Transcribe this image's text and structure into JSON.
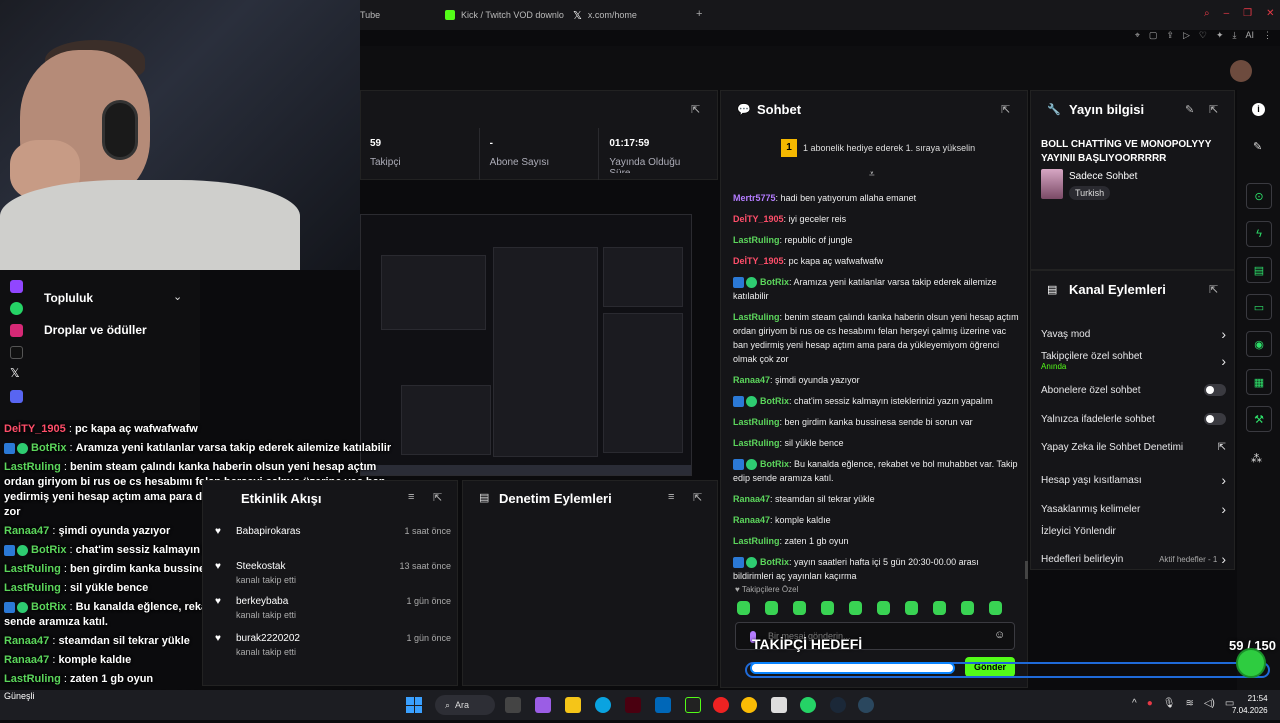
{
  "browser": {
    "tabs": [
      {
        "label": "Tube",
        "color": "#e62117"
      },
      {
        "label": "Kick / Twitch VOD downlo",
        "color": "#53fc18"
      },
      {
        "label": "x.com/home",
        "color": "#ffffff"
      }
    ],
    "new_tab": "+",
    "ai_label": "AI"
  },
  "stats": {
    "followers_value": "59",
    "followers_label": "Takipçi",
    "subs_value": "-",
    "subs_label": "Abone Sayısı",
    "uptime_value": "01:17:59",
    "uptime_label": "Yayında Olduğu Süre"
  },
  "chat": {
    "title": "Sohbet",
    "gift_banner": "1 abonelik hediye ederek 1. sıraya yükselin",
    "gift_rank": "1",
    "messages": [
      {
        "user": "Mertr5775",
        "color": "purple",
        "text": "hadi ben yatıyorum allaha emanet",
        "bot": false
      },
      {
        "user": "DeİTY_1905",
        "color": "red",
        "text": "iyi geceler reis",
        "bot": false
      },
      {
        "user": "LastRuling",
        "color": "green",
        "text": "republic of jungle",
        "bot": false
      },
      {
        "user": "DeİTY_1905",
        "color": "red",
        "text": "pc kapa aç wafwafwafw",
        "bot": false
      },
      {
        "user": "BotRix",
        "color": "green",
        "text": "Aramıza yeni katılanlar varsa takip ederek ailemize katılabilir",
        "bot": true
      },
      {
        "user": "LastRuling",
        "color": "green",
        "text": "benim steam çalındı kanka haberin olsun yeni hesap açtım ordan giriyom bi rus oe cs hesabımı felan herşeyi çalmış üzerine vac ban yedirmiş yeni hesap açtım ama para da yükleyemiyom öğrenci olmak çok zor",
        "bot": false
      },
      {
        "user": "Ranaa47",
        "color": "green",
        "text": "şimdi oyunda yazıyor",
        "bot": false
      },
      {
        "user": "BotRix",
        "color": "green",
        "text": "chat'im sessiz kalmayın isteklerinizi yazın yapalım",
        "bot": true
      },
      {
        "user": "LastRuling",
        "color": "green",
        "text": "ben girdim kanka bussinesa sende bi sorun var",
        "bot": false
      },
      {
        "user": "LastRuling",
        "color": "green",
        "text": "sil yükle bence",
        "bot": false
      },
      {
        "user": "BotRix",
        "color": "green",
        "text": "Bu kanalda eğlence, rekabet ve bol muhabbet var. Takip edip sende aramıza katıl.",
        "bot": true
      },
      {
        "user": "Ranaa47",
        "color": "green",
        "text": "steamdan sil tekrar yükle",
        "bot": false
      },
      {
        "user": "Ranaa47",
        "color": "green",
        "text": "komple kaldıe",
        "bot": false
      },
      {
        "user": "LastRuling",
        "color": "green",
        "text": "zaten 1 gb oyun",
        "bot": false
      },
      {
        "user": "BotRix",
        "color": "green",
        "text": "yayın saatleri hafta içi 5 gün 20:30-00.00 arası bildirimleri aç yayınları kaçırma",
        "bot": true
      }
    ],
    "followers_only": "Takipçilere Özel",
    "input_placeholder": "Bir mesaj gönderin...",
    "send_label": "Gönder"
  },
  "overlay_chat": [
    {
      "user": "DeİTY_1905",
      "color": "red",
      "text": "pc kapa aç wafwafwafw",
      "bot": false
    },
    {
      "user": "BotRix",
      "color": "green",
      "text": "Aramıza yeni katılanlar varsa takip ederek ailemize katılabilir",
      "bot": true
    },
    {
      "user": "LastRuling",
      "color": "green",
      "text": "benim steam çalındı kanka haberin olsun yeni hesap açtım ordan giriyom bi rus oe cs hesabımı felan herşeyi çalmış üzerine vac ban yedirmiş yeni hesap açtım ama para da yükleyemiyom öğrenci olmak çok zor",
      "bot": false
    },
    {
      "user": "Ranaa47",
      "color": "green",
      "text": "şimdi oyunda yazıyor",
      "bot": false
    },
    {
      "user": "BotRix",
      "color": "green",
      "text": "chat'im sessiz kalmayın isteklerinizi yazın yapalım",
      "bot": true
    },
    {
      "user": "LastRuling",
      "color": "green",
      "text": "ben girdim kanka bussinesa sende bi sorun var",
      "bot": false
    },
    {
      "user": "LastRuling",
      "color": "green",
      "text": "sil yükle bence",
      "bot": false
    },
    {
      "user": "BotRix",
      "color": "green",
      "text": "Bu kanalda eğlence, rekabet ve bol muhabbet var. Takip edip sende aramıza katıl.",
      "bot": true
    },
    {
      "user": "Ranaa47",
      "color": "green",
      "text": "steamdan sil tekrar yükle",
      "bot": false
    },
    {
      "user": "Ranaa47",
      "color": "green",
      "text": "komple kaldıe",
      "bot": false
    },
    {
      "user": "LastRuling",
      "color": "green",
      "text": "zaten 1 gb oyun",
      "bot": false
    },
    {
      "user": "BotRix",
      "color": "green",
      "text": "yayın saatleri hafta içi 5 gün 20:30-00.00 arası bildirimleri aç yayınları",
      "bot": true
    }
  ],
  "stream_info": {
    "title": "Yayın bilgisi",
    "stream_title": "BOLL CHATTİNG VE MONOPOLYYY YAYINII BAŞLIYOORRRRR",
    "category": "Sadece Sohbet",
    "language": "Turkish"
  },
  "channel_actions": {
    "title": "Kanal Eylemleri",
    "items": [
      {
        "label": "Yavaş mod",
        "control": "chevron"
      },
      {
        "label": "Takipçilere özel sohbet",
        "sub": "Anında",
        "control": "chevron"
      },
      {
        "label": "Abonelere özel sohbet",
        "control": "toggle"
      },
      {
        "label": "Yalnızca ifadelerle sohbet",
        "control": "toggle"
      },
      {
        "label": "Yapay Zeka ile Sohbet Denetimi",
        "control": "external"
      },
      {
        "label": "Hesap yaşı kısıtlaması",
        "control": "chevron"
      },
      {
        "label": "Yasaklanmış kelimeler",
        "control": "chevron"
      },
      {
        "label": "İzleyici Yönlendir",
        "control": "none"
      },
      {
        "label": "Hedefleri belirleyin",
        "sub2": "Aktif hedefler - 1",
        "control": "chevron"
      }
    ]
  },
  "sidebar": {
    "community": "Topluluk",
    "drops": "Droplar ve ödüller"
  },
  "activity": {
    "title": "Etkinlik Akışı",
    "items": [
      {
        "user": "Babapirokaras",
        "time": "1 saat önce",
        "action": ""
      },
      {
        "user": "Steekostak",
        "time": "13 saat önce",
        "action": "kanalı takip etti"
      },
      {
        "user": "berkeybaba",
        "time": "1 gün önce",
        "action": "kanalı takip etti"
      },
      {
        "user": "burak2220202",
        "time": "1 gün önce",
        "action": "kanalı takip etti"
      }
    ]
  },
  "moderation": {
    "title": "Denetim Eylemleri"
  },
  "goal": {
    "label": "TAKİPÇİ HEDEFİ",
    "count": "59 / 150",
    "progress": 0.39
  },
  "taskbar": {
    "search": "Ara",
    "time": "21:54",
    "date": "7.04.2026",
    "weather": "Güneşli"
  },
  "colors": {
    "accent": "#53fc18",
    "bot": "#2b79d6",
    "user_red": "#ff4e6a",
    "user_green": "#5cd65c",
    "user_purple": "#b47cff"
  }
}
